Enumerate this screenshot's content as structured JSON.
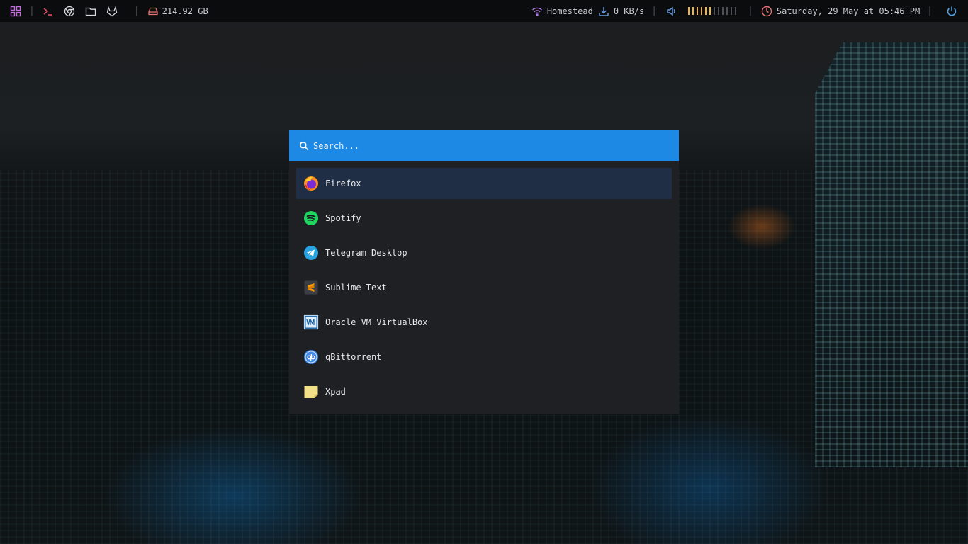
{
  "topbar": {
    "disk": "214.92 GB",
    "wifi_name": "Homestead",
    "net_speed": "0 KB/s",
    "volume_level": 0.5,
    "datetime": "Saturday, 29 May at 05:46 PM",
    "icons": [
      "apps-grid-icon",
      "terminal-icon",
      "chrome-icon",
      "folder-icon",
      "gitlab-icon",
      "disk-icon",
      "wifi-icon",
      "download-icon",
      "volume-icon",
      "clock-icon",
      "power-icon"
    ],
    "colors": {
      "grid": "#c46be0",
      "terminal": "#e0506a",
      "disk": "#e57373",
      "wifi": "#b07be8",
      "download": "#6aa0e8",
      "volume": "#6aa0e8",
      "volume_bar_on": "#f2b33d",
      "clock": "#e57373",
      "power": "#4fa3e8"
    }
  },
  "launcher": {
    "search_placeholder": "Search...",
    "accent": "#1e88e5",
    "selected_bg": "#1f2e44",
    "apps": [
      {
        "label": "Firefox",
        "icon": "firefox-icon"
      },
      {
        "label": "Spotify",
        "icon": "spotify-icon"
      },
      {
        "label": "Telegram Desktop",
        "icon": "telegram-icon"
      },
      {
        "label": "Sublime Text",
        "icon": "sublime-text-icon"
      },
      {
        "label": "Oracle VM VirtualBox",
        "icon": "virtualbox-icon"
      },
      {
        "label": "qBittorrent",
        "icon": "qbittorrent-icon"
      },
      {
        "label": "Xpad",
        "icon": "xpad-icon"
      }
    ]
  }
}
